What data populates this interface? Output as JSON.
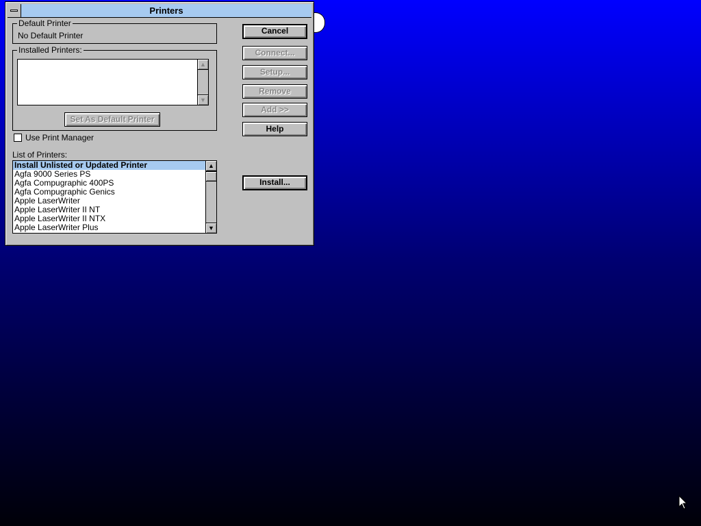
{
  "dialog": {
    "title": "Printers",
    "default_printer": {
      "label": "Default Printer",
      "value": "No Default Printer"
    },
    "installed_printers": {
      "label": "Installed Printers:",
      "items": []
    },
    "set_default_button": "Set As Default Printer",
    "use_print_manager": {
      "label": "Use Print Manager",
      "checked": false
    },
    "list_of_printers": {
      "label": "List of Printers:",
      "selected": "Install Unlisted or Updated Printer",
      "items": [
        "Install Unlisted or Updated Printer",
        "Agfa 9000 Series PS",
        "Agfa Compugraphic 400PS",
        "Agfa Compugraphic Genics",
        "Apple LaserWriter",
        "Apple LaserWriter II NT",
        "Apple LaserWriter II NTX",
        "Apple LaserWriter Plus"
      ]
    },
    "buttons": {
      "cancel": "Cancel",
      "connect": "Connect...",
      "setup": "Setup...",
      "remove": "Remove",
      "add": "Add >>",
      "help": "Help",
      "install": "Install..."
    }
  },
  "icons": {
    "system_menu": "system-menu-icon",
    "scroll_up": "▲",
    "scroll_down": "▼",
    "cursor": "mouse-pointer-icon"
  },
  "colors": {
    "title_bar": "#a6caf0",
    "dialog_face": "#c0c0c0",
    "selection": "#a6caf0",
    "desktop_top": "#0000ff",
    "desktop_bottom": "#000008"
  }
}
